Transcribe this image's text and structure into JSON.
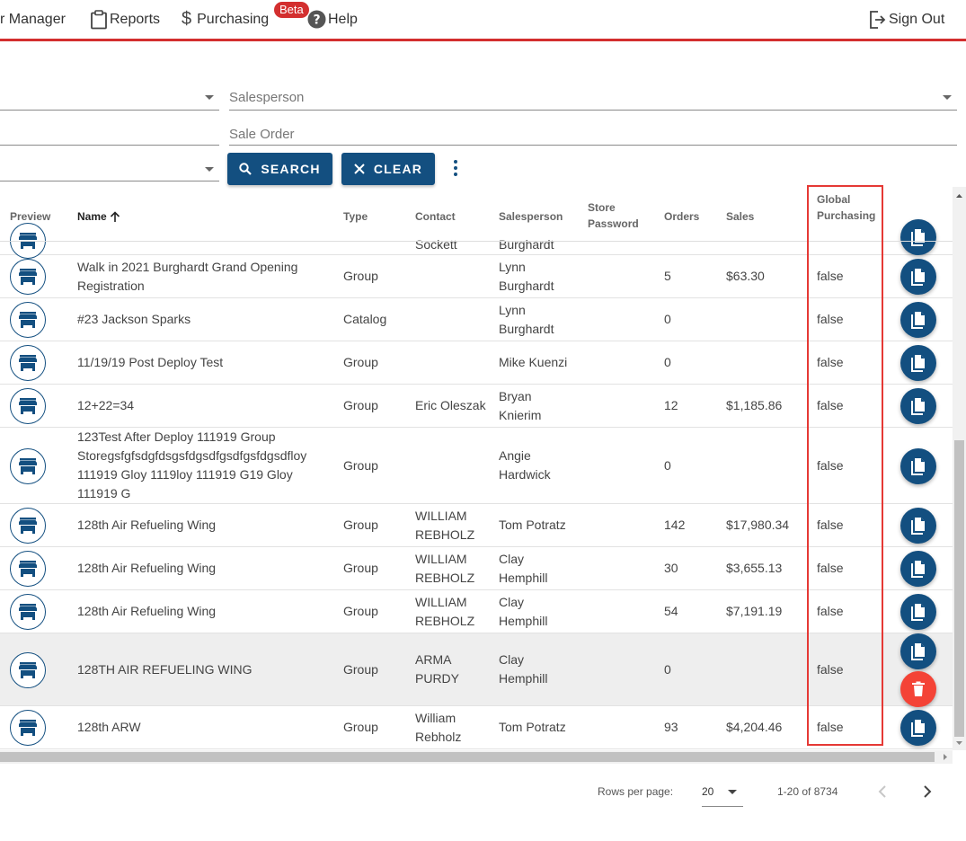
{
  "nav": {
    "items": [
      {
        "label": "r Manager",
        "icon": "none"
      },
      {
        "label": "Reports",
        "icon": "clipboard-icon"
      },
      {
        "label": "Purchasing",
        "icon": "dollar-icon"
      },
      {
        "label": "Help",
        "icon": "help-circle-icon"
      }
    ],
    "beta": "Beta",
    "sign_out": "Sign Out"
  },
  "filters": {
    "salesperson_label": "Salesperson",
    "sale_order_label": "Sale Order",
    "search_label": "SEARCH",
    "clear_label": "CLEAR"
  },
  "table": {
    "headers": {
      "preview": "Preview",
      "name": "Name",
      "type": "Type",
      "contact": "Contact",
      "salesperson": "Salesperson",
      "store_password_1": "Store",
      "store_password_2": "Password",
      "orders": "Orders",
      "sales": "Sales",
      "global_1": "Global",
      "global_2": "Purchasing"
    },
    "partial_row": {
      "contact": "Sockett",
      "salesperson": "Burghardt"
    },
    "rows": [
      {
        "name": "Walk in 2021 Burghardt Grand Opening Registration",
        "type": "Group",
        "contact": "",
        "salesperson": "Lynn Burghardt",
        "orders": "5",
        "sales": "$63.30",
        "global": "false"
      },
      {
        "name": "#23 Jackson Sparks",
        "type": "Catalog",
        "contact": "",
        "salesperson": "Lynn Burghardt",
        "orders": "0",
        "sales": "",
        "global": "false"
      },
      {
        "name": "11/19/19 Post Deploy Test",
        "type": "Group",
        "contact": "",
        "salesperson": "Mike Kuenzi",
        "orders": "0",
        "sales": "",
        "global": "false"
      },
      {
        "name": "12+22=34",
        "type": "Group",
        "contact": "Eric Oleszak",
        "salesperson": "Bryan Knierim",
        "orders": "12",
        "sales": "$1,185.86",
        "global": "false"
      },
      {
        "name": "123Test After Deploy 111919 Group Storegsfgfsdgfdsgsfdgsdfgsdfgsfdgsdfloy 111919 Gloy 1119loy 111919 G19 Gloy 111919 G",
        "type": "Group",
        "contact": "",
        "salesperson": "Angie Hardwick",
        "orders": "0",
        "sales": "",
        "global": "false"
      },
      {
        "name": "128th Air Refueling Wing",
        "type": "Group",
        "contact": "WILLIAM REBHOLZ",
        "salesperson": "Tom Potratz",
        "orders": "142",
        "sales": "$17,980.34",
        "global": "false"
      },
      {
        "name": "128th Air Refueling Wing",
        "type": "Group",
        "contact": "WILLIAM REBHOLZ",
        "salesperson": "Clay Hemphill",
        "orders": "30",
        "sales": "$3,655.13",
        "global": "false"
      },
      {
        "name": "128th Air Refueling Wing",
        "type": "Group",
        "contact": "WILLIAM REBHOLZ",
        "salesperson": "Clay Hemphill",
        "orders": "54",
        "sales": "$7,191.19",
        "global": "false"
      },
      {
        "name": "128TH AIR REFUELING WING",
        "type": "Group",
        "contact": "ARMA PURDY",
        "salesperson": "Clay Hemphill",
        "orders": "0",
        "sales": "",
        "global": "false"
      },
      {
        "name": "128th ARW",
        "type": "Group",
        "contact": "William Rebholz",
        "salesperson": "Tom Potratz",
        "orders": "93",
        "sales": "$4,204.46",
        "global": "false"
      }
    ]
  },
  "pagination": {
    "rows_per_page_label": "Rows per page:",
    "rows_per_page": "20",
    "range": "1-20 of 8734"
  },
  "colors": {
    "brand": "#134f80",
    "accent_red": "#d32f2f",
    "delete_red": "#f44336"
  }
}
